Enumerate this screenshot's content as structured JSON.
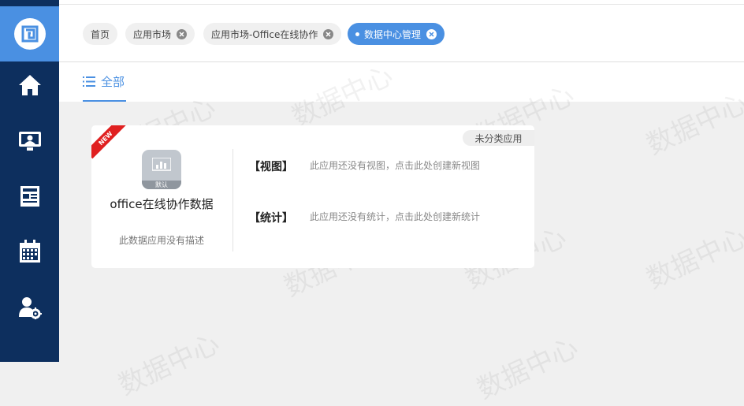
{
  "sidebar": {
    "logo": "logo-icon",
    "items": [
      {
        "name": "home",
        "icon": "home-icon"
      },
      {
        "name": "monitor-user",
        "icon": "monitor-user-icon"
      },
      {
        "name": "news",
        "icon": "news-icon"
      },
      {
        "name": "calendar",
        "icon": "calendar-icon"
      },
      {
        "name": "user-settings",
        "icon": "user-settings-icon"
      }
    ],
    "background": "#0d2f5e",
    "accent": "#4a90e2"
  },
  "tabs": [
    {
      "label": "首页",
      "closable": false,
      "active": false
    },
    {
      "label": "应用市场",
      "closable": true,
      "active": false
    },
    {
      "label": "应用市场-Office在线协作",
      "closable": true,
      "active": false
    },
    {
      "label": "数据中心管理",
      "closable": true,
      "active": true
    }
  ],
  "toolbar": {
    "all_label": "全部"
  },
  "watermark": {
    "text": "数据中心"
  },
  "card": {
    "ribbon": "NEW",
    "category_badge": "未分类应用",
    "icon_label": "默认",
    "app_name": "office在线协作数据",
    "app_desc": "此数据应用没有描述",
    "view_title": "【视图】",
    "view_link": "此应用还没有视图，点击此处创建新视图",
    "stats_title": "【统计】",
    "stats_link": "此应用还没有统计，点击此处创建新统计"
  }
}
